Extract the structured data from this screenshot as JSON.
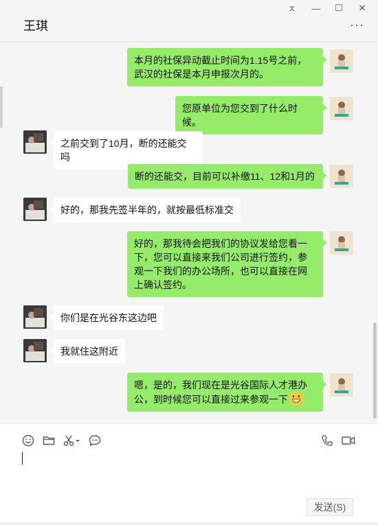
{
  "window": {
    "title": "王琪",
    "controls": {
      "pin": "ㅈ",
      "minimize": "—",
      "maximize": "☐",
      "close": "✕"
    },
    "more": "···"
  },
  "messages": [
    {
      "side": "self",
      "text": "本月的社保异动截止时间为1.15号之前，武汉的社保是本月申报次月的。"
    },
    {
      "side": "self",
      "text": "您原单位为您交到了什么时候。"
    },
    {
      "side": "other",
      "text": "之前交到了10月，断的还能交吗"
    },
    {
      "side": "self",
      "text": "断的还能交，目前可以补缴11、12和1月的"
    },
    {
      "side": "other",
      "text": "好的，那我先签半年的，就按最低标准交"
    },
    {
      "side": "self",
      "text": "好的，那我待会把我们的协议发给您看一下，您可以直接来我们公司进行签约，参观一下我们的办公场所，也可以直接在网上确认签约。"
    },
    {
      "side": "other",
      "text": "你们是在光谷东这边吧"
    },
    {
      "side": "other",
      "text": "我就住这附近"
    },
    {
      "side": "self",
      "text": "嗯，是的，我们现在是光谷国际人才港办公，到时候您可以直接过来参观一下",
      "emoji": "grin-emoji"
    }
  ],
  "toolbar": {
    "icons": [
      "smiley-icon",
      "folder-icon",
      "scissors-icon",
      "chat-bubble-icon",
      "phone-icon",
      "video-icon"
    ]
  },
  "input": {
    "value": ""
  },
  "send_button": {
    "label": "发送(S)"
  },
  "colors": {
    "self_bubble": "#95ec69",
    "other_bubble": "#ffffff",
    "background": "#f5f5f5"
  }
}
